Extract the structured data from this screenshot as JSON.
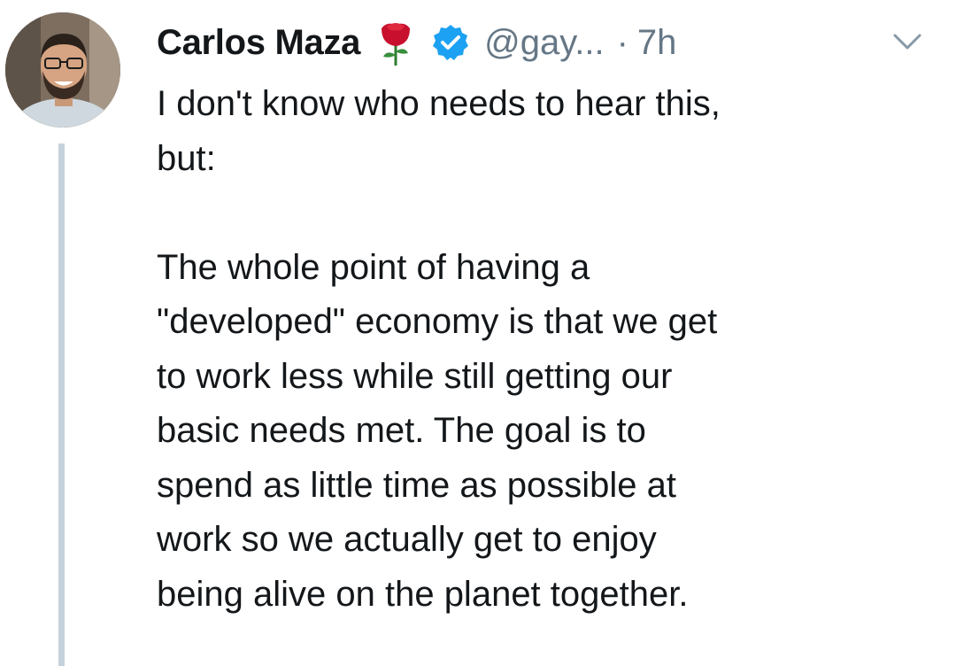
{
  "tweet": {
    "author": {
      "display_name": "Carlos Maza",
      "handle": "@gay...",
      "emoji_icon": "rose-icon",
      "verified_icon": "verified-badge-icon"
    },
    "separator": "·",
    "timestamp": "7h",
    "menu_icon": "chevron-down-icon",
    "text": "I don't know who needs to hear this,\nbut:\n\nThe whole point of having a\n\"developed\" economy is that we get\nto work less while still getting our\nbasic needs met. The goal is to\nspend as little time as possible at\nwork so we actually get to enjoy\nbeing alive on the planet together."
  },
  "colors": {
    "text_primary": "#14171a",
    "text_secondary": "#657786",
    "verified_blue": "#1da1f2",
    "thread_line": "#c6d2db",
    "rose_red": "#c8102e"
  }
}
